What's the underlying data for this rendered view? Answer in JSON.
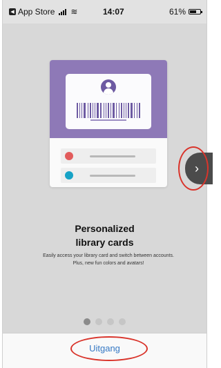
{
  "status_bar": {
    "back_app": "App Store",
    "time": "14:07",
    "battery": "61%",
    "battery_level": 0.61
  },
  "onboarding": {
    "title": "Personalized\nlibrary cards",
    "subtitle": "Easily access your library card and switch between accounts. Plus, new fun colors and avatars!",
    "next_glyph": "›",
    "page_count": 4,
    "current_page": 1
  },
  "footer": {
    "exit_label": "Uitgang"
  },
  "colors": {
    "accent_purple": "#8e79b7",
    "avatar_purple": "#6d5aa2",
    "row_dot_red": "#e25c5c",
    "row_dot_teal": "#17a3c6",
    "link_blue": "#3578c4",
    "annotation_red": "#d9342b"
  },
  "icons": {
    "back": "back-arrow-icon",
    "signal": "cellular-signal-icon",
    "wifi": "wifi-icon",
    "battery": "battery-icon",
    "avatar": "user-avatar-icon",
    "barcode": "barcode-icon",
    "next": "chevron-right-icon"
  }
}
